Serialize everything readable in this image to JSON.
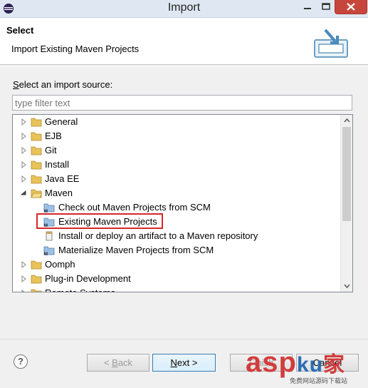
{
  "window": {
    "title": "Import"
  },
  "header": {
    "title": "Select",
    "description": "Import Existing Maven Projects"
  },
  "source": {
    "label_prefix": "S",
    "label_rest": "elect an import source:",
    "filter_placeholder": "type filter text",
    "filter_value": ""
  },
  "tree": {
    "items": [
      {
        "label": "General",
        "expanded": false
      },
      {
        "label": "EJB",
        "expanded": false
      },
      {
        "label": "Git",
        "expanded": false
      },
      {
        "label": "Install",
        "expanded": false
      },
      {
        "label": "Java EE",
        "expanded": false
      },
      {
        "label": "Maven",
        "expanded": true
      },
      {
        "label": "Check out Maven Projects from SCM",
        "icon": "maven-checkout-icon"
      },
      {
        "label": "Existing Maven Projects",
        "icon": "maven-project-icon",
        "selected": true
      },
      {
        "label": "Install or deploy an artifact to a Maven repository",
        "icon": "jar-icon"
      },
      {
        "label": "Materialize Maven Projects from SCM",
        "icon": "maven-materialize-icon"
      },
      {
        "label": "Oomph",
        "expanded": false
      },
      {
        "label": "Plug-in Development",
        "expanded": false
      },
      {
        "label": "Remote Systems",
        "expanded": false
      }
    ]
  },
  "buttons": {
    "help": "?",
    "back_mnemonic": "< ",
    "back_u": "B",
    "back_rest": "ack",
    "next_u": "N",
    "next_rest": "ext >",
    "finish": "Finish",
    "cancel": "Cancel"
  },
  "watermark": {
    "text": "asp",
    "text2": "ku",
    "cn": "家",
    "sub": "免费网站源码下载站"
  },
  "colors": {
    "highlight_border": "#d6282b",
    "folder": "#e8c35a",
    "accent": "#3c7fb1"
  }
}
